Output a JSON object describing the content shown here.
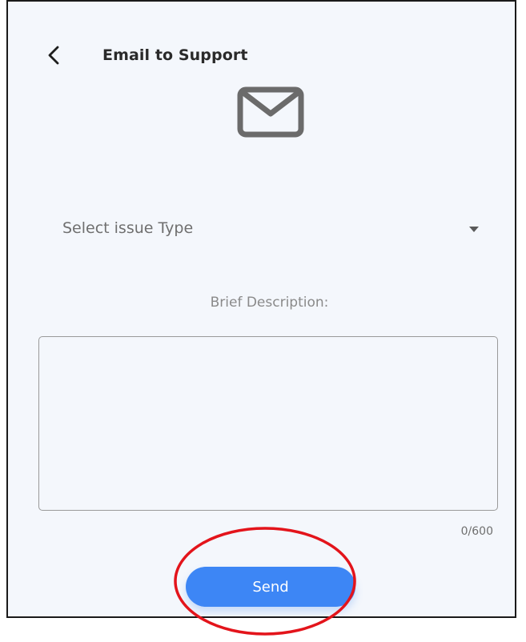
{
  "header": {
    "title": "Email to Support"
  },
  "form": {
    "issue_type_placeholder": "Select issue Type",
    "description_label": "Brief Description:",
    "description_value": "",
    "counter": "0/600",
    "send_label": "Send"
  },
  "icons": {
    "back": "chevron-left-icon",
    "mail": "envelope-icon",
    "dropdown": "caret-down-icon"
  },
  "colors": {
    "background": "#f4f7fc",
    "primary": "#3d86f5",
    "annotation": "#e3141b"
  }
}
